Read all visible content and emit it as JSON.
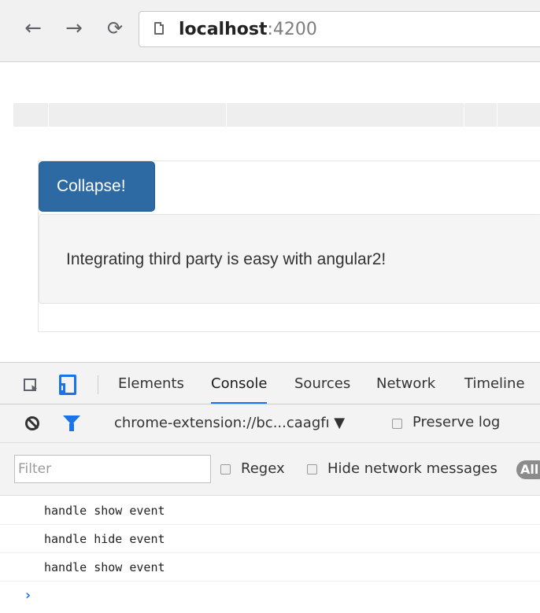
{
  "browser": {
    "back_icon": "back-arrow-icon",
    "forward_icon": "forward-arrow-icon",
    "reload_icon": "reload-icon",
    "url_host": "localhost",
    "url_port": ":4200"
  },
  "page": {
    "collapse_button_label": "Collapse!",
    "well_text": "Integrating third party is easy with angular2!"
  },
  "devtools": {
    "tabs": [
      "Elements",
      "Console",
      "Sources",
      "Network",
      "Timeline"
    ],
    "active_tab": "Console",
    "context": "chrome-extension://bc...caagfı ▼",
    "preserve_log_label": "Preserve log",
    "filter_placeholder": "Filter",
    "regex_label": "Regex",
    "hide_network_label": "Hide network messages",
    "level_pill": "All",
    "console_lines": [
      "handle show event",
      "handle hide event",
      "handle show event"
    ],
    "prompt": "›"
  },
  "colors": {
    "accent": "#1a73e8",
    "button": "#2d6aa3"
  }
}
